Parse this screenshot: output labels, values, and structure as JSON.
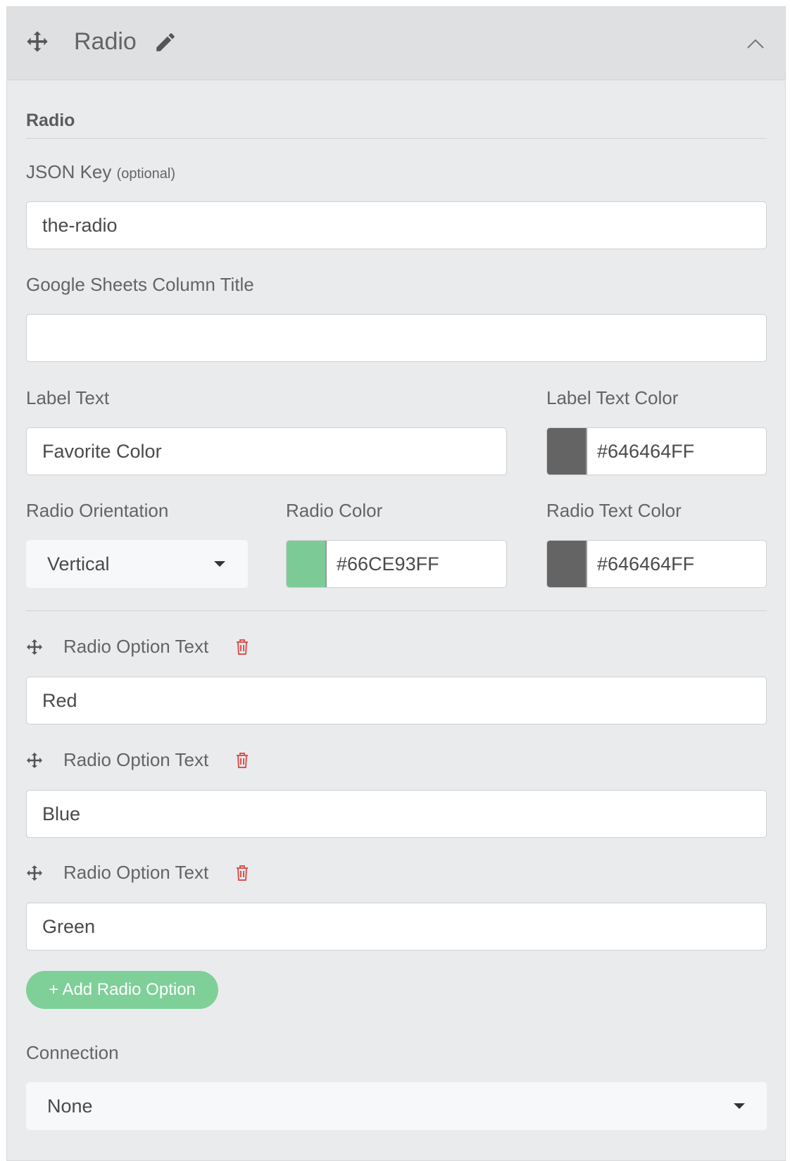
{
  "header": {
    "title": "Radio"
  },
  "section": {
    "title": "Radio"
  },
  "json_key": {
    "label": "JSON Key",
    "optional": "(optional)",
    "value": "the-radio"
  },
  "sheets": {
    "label": "Google Sheets Column Title",
    "value": ""
  },
  "label_text": {
    "label": "Label Text",
    "value": "Favorite Color"
  },
  "label_text_color": {
    "label": "Label Text Color",
    "hex": "#646464FF",
    "swatch": "#646464"
  },
  "radio_orientation": {
    "label": "Radio Orientation",
    "value": "Vertical"
  },
  "radio_color": {
    "label": "Radio Color",
    "hex": "#66CE93FF",
    "swatch": "#7ccb96"
  },
  "radio_text_color": {
    "label": "Radio Text Color",
    "hex": "#646464FF",
    "swatch": "#646464"
  },
  "options": [
    {
      "label": "Radio Option Text",
      "value": "Red"
    },
    {
      "label": "Radio Option Text",
      "value": "Blue"
    },
    {
      "label": "Radio Option Text",
      "value": "Green"
    }
  ],
  "add_option_label": "+ Add Radio Option",
  "connection": {
    "label": "Connection",
    "value": "None"
  },
  "colors": {
    "accent_green": "#7fcf99",
    "danger_red": "#d9534f"
  }
}
